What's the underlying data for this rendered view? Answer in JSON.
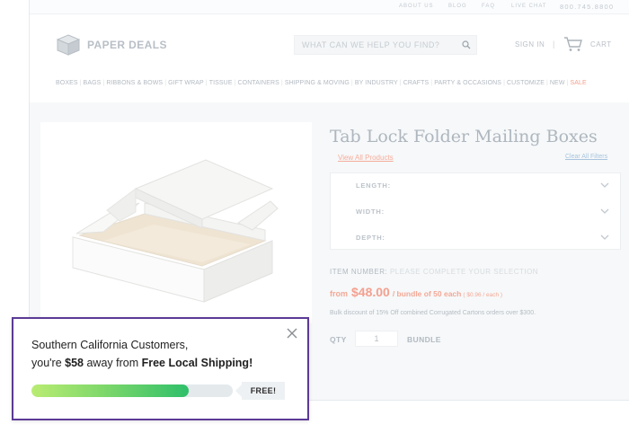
{
  "utility_nav": {
    "links": [
      "ABOUT US",
      "BLOG",
      "FAQ",
      "LIVE CHAT"
    ],
    "phone": "800.745.8800"
  },
  "header": {
    "logo_text": "PAPER DEALS",
    "search_placeholder": "WHAT CAN WE HELP YOU FIND?",
    "sign_in": "SIGN IN",
    "separator": "|",
    "cart": "CART"
  },
  "nav": {
    "items": [
      "BOXES",
      "BAGS",
      "RIBBONS & BOWS",
      "GIFT WRAP",
      "TISSUE",
      "CONTAINERS",
      "SHIPPING & MOVING",
      "BY INDUSTRY",
      "CRAFTS",
      "PARTY & OCCASIONS",
      "CUSTOMIZE",
      "NEW",
      "SALE"
    ]
  },
  "product": {
    "title": "Tab Lock Folder Mailing Boxes",
    "view_all": "View All Products",
    "clear_filters": "Clear All Filters",
    "filters": [
      {
        "label": "LENGTH:"
      },
      {
        "label": "WIDTH:"
      },
      {
        "label": "DEPTH:"
      }
    ],
    "item_number_label": "ITEM NUMBER:",
    "item_number_value": "PLEASE COMPLETE YOUR SELECTION",
    "price_from": "from",
    "price": "$48.00",
    "price_bundle": "/ bundle of 50 each",
    "price_each": "( $0.96 / each )",
    "bulk_note": "Bulk discount of 15% Off combined Corrugated Cartons orders over $300.",
    "qty_label": "QTY",
    "qty_value": "1",
    "qty_unit": "BUNDLE"
  },
  "popup": {
    "line1": "Southern California Customers,",
    "line2_prefix": "you're ",
    "line2_amount": "$58",
    "line2_middle": " away from ",
    "line2_emphasis": "Free Local Shipping!",
    "progress_fraction": 0.78,
    "free_label": "FREE!"
  },
  "colors": {
    "popup_border": "#5b3a96",
    "price_accent": "#f4a08f",
    "progress_start": "#b9ec73",
    "progress_end": "#2fbf6a"
  }
}
